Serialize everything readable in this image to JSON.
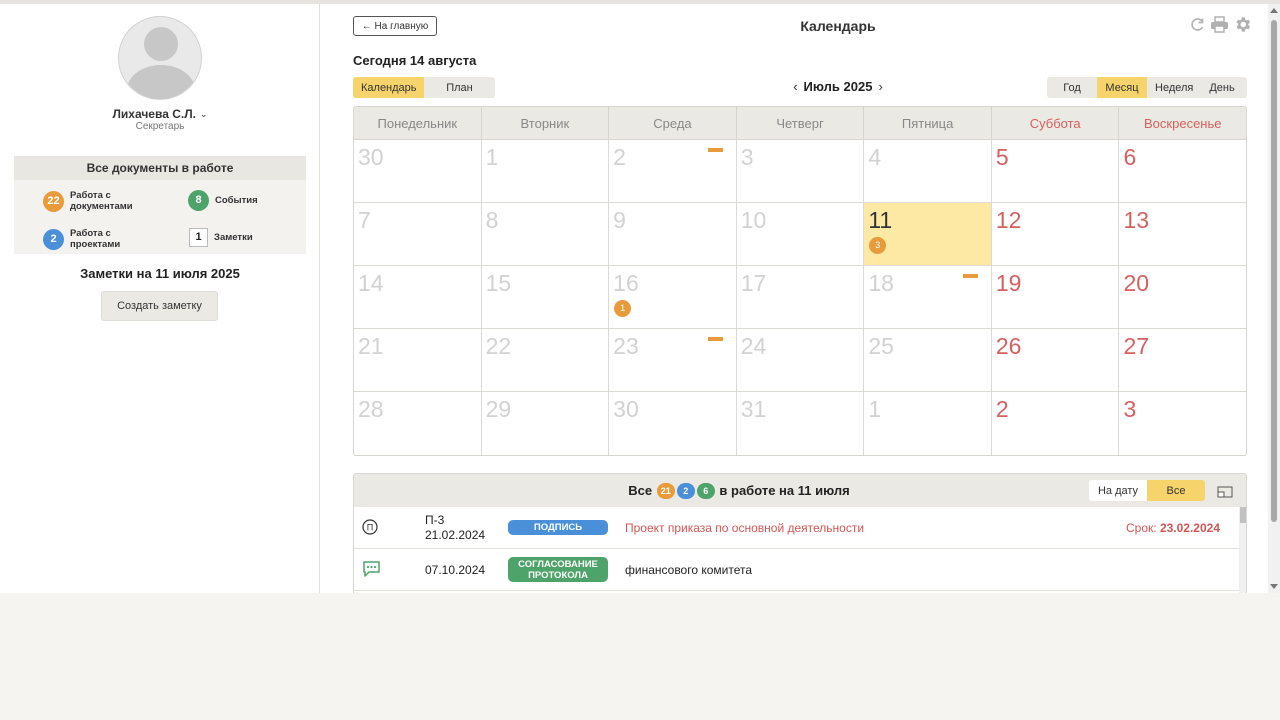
{
  "user": {
    "name": "Лихачева С.Л.",
    "role": "Секретарь"
  },
  "docs_summary": {
    "title": "Все документы в работе",
    "stats": [
      {
        "count": "22",
        "label": "Работа с документами",
        "color": "#e89b3b"
      },
      {
        "count": "8",
        "label": "События",
        "color": "#4ea36a"
      },
      {
        "count": "2",
        "label": "Работа с проектами",
        "color": "#4a90d9"
      },
      {
        "count": "1",
        "label": "Заметки"
      }
    ]
  },
  "notes": {
    "title": "Заметки на 11 июля 2025",
    "create_label": "Создать заметку"
  },
  "header": {
    "back_label": "← На главную",
    "title": "Календарь",
    "icons": [
      "refresh-icon",
      "print-icon",
      "gear-icon"
    ]
  },
  "today_label": "Сегодня 14 августа",
  "view_toggle": {
    "items": [
      "Календарь",
      "План"
    ],
    "active": 0
  },
  "month_nav": {
    "prev": "‹",
    "label": "Июль 2025",
    "next": "›"
  },
  "scale_toggle": {
    "items": [
      "Год",
      "Месяц",
      "Неделя",
      "День"
    ],
    "active": 1
  },
  "calendar": {
    "weekdays": [
      "Понедельник",
      "Вторник",
      "Среда",
      "Четверг",
      "Пятница",
      "Суббота",
      "Воскресенье"
    ],
    "weeks": [
      [
        {
          "d": "30"
        },
        {
          "d": "1"
        },
        {
          "d": "2",
          "dash": true
        },
        {
          "d": "3"
        },
        {
          "d": "4"
        },
        {
          "d": "5",
          "weekend": true
        },
        {
          "d": "6",
          "weekend": true
        }
      ],
      [
        {
          "d": "7"
        },
        {
          "d": "8"
        },
        {
          "d": "9"
        },
        {
          "d": "10"
        },
        {
          "d": "11",
          "selected": true,
          "badge": "3"
        },
        {
          "d": "12",
          "weekend": true
        },
        {
          "d": "13",
          "weekend": true
        }
      ],
      [
        {
          "d": "14"
        },
        {
          "d": "15"
        },
        {
          "d": "16",
          "badge": "1"
        },
        {
          "d": "17"
        },
        {
          "d": "18",
          "dash": true
        },
        {
          "d": "19",
          "weekend": true
        },
        {
          "d": "20",
          "weekend": true
        }
      ],
      [
        {
          "d": "21"
        },
        {
          "d": "22"
        },
        {
          "d": "23",
          "dash": true
        },
        {
          "d": "24"
        },
        {
          "d": "25"
        },
        {
          "d": "26",
          "weekend": true
        },
        {
          "d": "27",
          "weekend": true
        }
      ],
      [
        {
          "d": "28"
        },
        {
          "d": "29"
        },
        {
          "d": "30"
        },
        {
          "d": "31"
        },
        {
          "d": "1"
        },
        {
          "d": "2",
          "weekend": true
        },
        {
          "d": "3",
          "weekend": true
        }
      ]
    ]
  },
  "work_panel": {
    "prefix": "Все",
    "counts": [
      {
        "value": "21",
        "color": "#e89b3b"
      },
      {
        "value": "2",
        "color": "#4a90d9"
      },
      {
        "value": "6",
        "color": "#4ea36a"
      }
    ],
    "suffix": "в работе на 11 июля",
    "filter": {
      "items": [
        "На дату",
        "Все"
      ],
      "active": 1
    },
    "rows": [
      {
        "icon": "project-icon",
        "code": "П-3",
        "date": "21.02.2024",
        "tag": "ПОДПИСЬ",
        "tag_color": "#4a90d9",
        "subject": "Проект приказа по основной деятельности",
        "subject_color": "#d25555",
        "deadline_label": "Срок:",
        "deadline": "23.02.2024"
      },
      {
        "icon": "chat-icon",
        "code": "",
        "date": "07.10.2024",
        "tag": "СОГЛАСОВАНИЕ ПРОТОКОЛА",
        "tag_color": "#4ea36a",
        "subject": "финансового комитета",
        "subject_color": "#222222",
        "deadline_label": "",
        "deadline": ""
      }
    ]
  }
}
